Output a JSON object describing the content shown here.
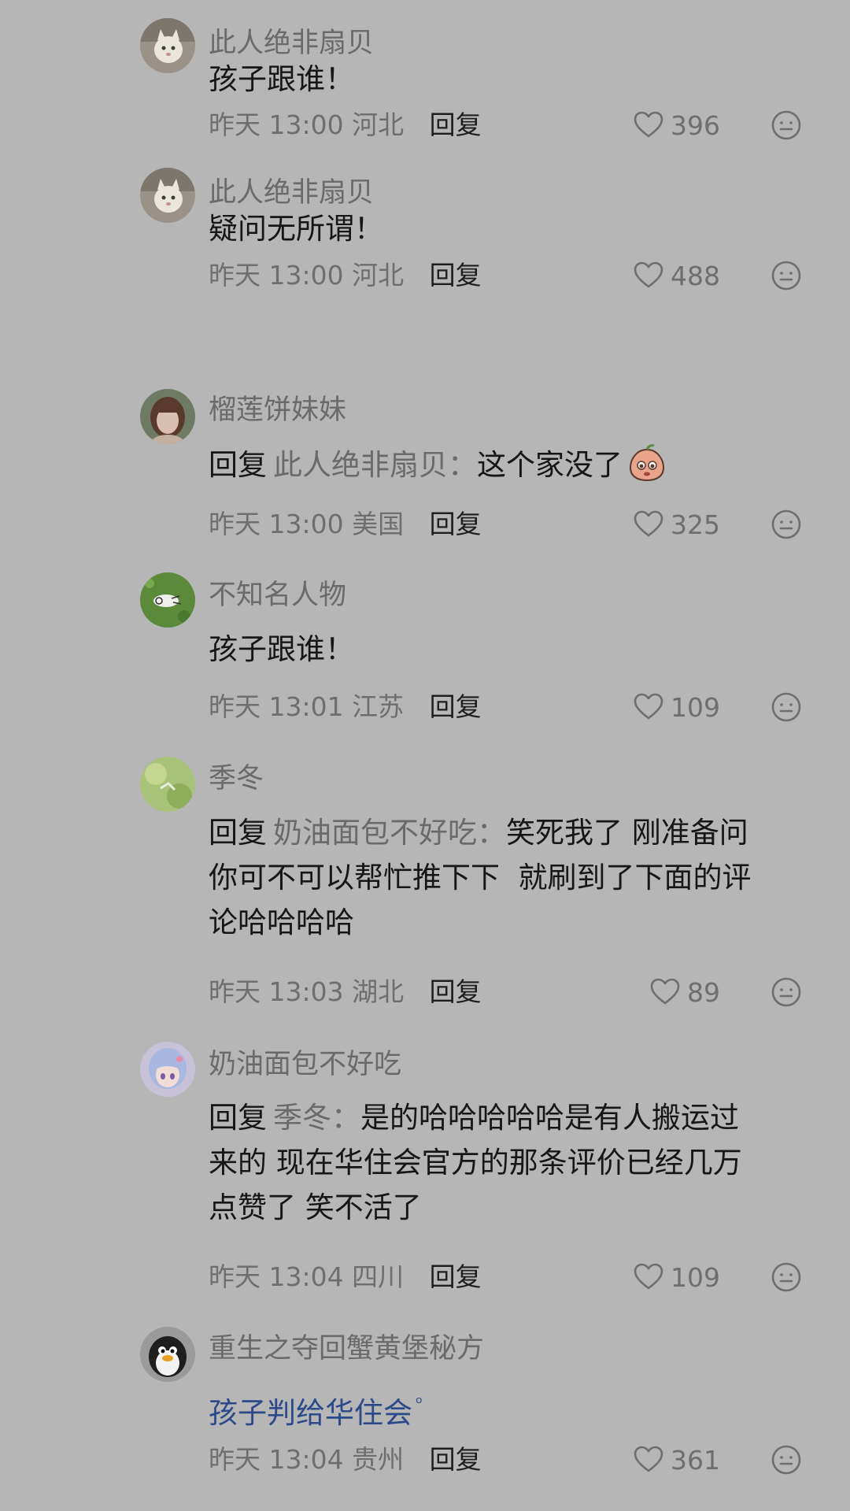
{
  "comments": [
    {
      "username": "此人绝非扇贝",
      "text": "孩子跟谁！",
      "time": "昨天 13:00",
      "location": "河北",
      "reply_label": "回复",
      "likes": "396",
      "avatar": "cat-avatar"
    },
    {
      "username": "此人绝非扇贝",
      "text": "疑问无所谓！",
      "time": "昨天 13:00",
      "location": "河北",
      "reply_label": "回复",
      "likes": "488",
      "avatar": "cat-avatar"
    },
    {
      "username": "榴莲饼妹妹",
      "reply_prefix": "回复",
      "reply_target": "此人绝非扇贝：",
      "text": "这个家没了",
      "sticker": "crying-peach-sticker",
      "time": "昨天 13:00",
      "location": "美国",
      "reply_label": "回复",
      "likes": "325",
      "avatar": "girl-avatar"
    },
    {
      "username": "不知名人物",
      "text": "孩子跟谁！",
      "time": "昨天 13:01",
      "location": "江苏",
      "reply_label": "回复",
      "likes": "109",
      "avatar": "green-doodle-avatar"
    },
    {
      "username": "季冬",
      "reply_prefix": "回复",
      "reply_target": "奶油面包不好吃：",
      "lines": [
        "笑死我了 刚准备问",
        "你可不可以帮忙推下下  就刷到了下面的评",
        "论哈哈哈哈"
      ],
      "time": "昨天 13:03",
      "location": "湖北",
      "reply_label": "回复",
      "likes": "89",
      "avatar": "light-green-avatar"
    },
    {
      "username": "奶油面包不好吃",
      "reply_prefix": "回复",
      "reply_target": "季冬：",
      "lines": [
        "是的哈哈哈哈哈是有人搬运过",
        "来的 现在华住会官方的那条评价已经几万",
        "点赞了 笑不活了"
      ],
      "time": "昨天 13:04",
      "location": "四川",
      "reply_label": "回复",
      "likes": "109",
      "avatar": "anime-girl-avatar"
    },
    {
      "username": "重生之夺回蟹黄堡秘方",
      "text": "孩子判给华住会",
      "text_mark": "ᵒ",
      "time": "昨天 13:04",
      "location": "贵州",
      "reply_label": "回复",
      "likes": "361",
      "avatar": "penguin-avatar"
    }
  ],
  "icons": {
    "like": "heart-outline-icon",
    "emoji": "neutral-face-icon"
  },
  "colors": {
    "background": "#b6b6b6",
    "username": "#6a6a6a",
    "text": "#161616",
    "link": "#2c4a8a"
  }
}
